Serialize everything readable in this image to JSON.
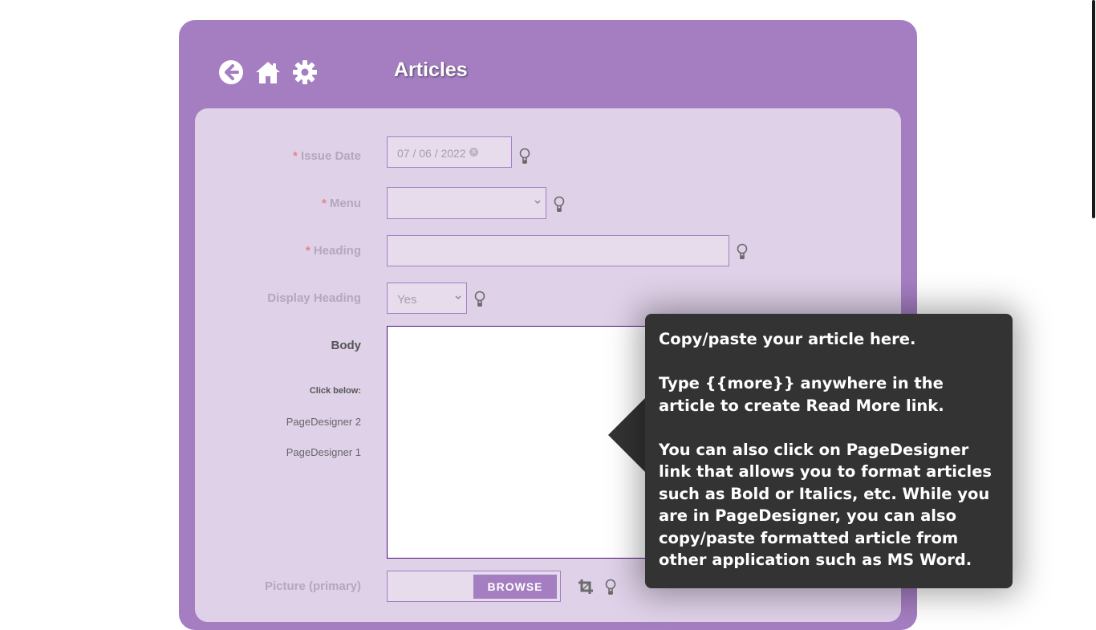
{
  "header": {
    "title": "Articles",
    "icons": [
      "back-arrow-icon",
      "home-icon",
      "gear-icon"
    ]
  },
  "form": {
    "issue_date": {
      "label": "Issue Date",
      "required_mark": "*",
      "value": "07 / 06 / 2022"
    },
    "menu": {
      "label": "Menu",
      "required_mark": "*",
      "value": ""
    },
    "heading": {
      "label": "Heading",
      "required_mark": "*",
      "value": ""
    },
    "display_heading": {
      "label": "Display Heading",
      "value": "Yes"
    },
    "body": {
      "label": "Body",
      "click_below": "Click below:",
      "links": [
        "PageDesigner 2",
        "PageDesigner 1"
      ],
      "value": ""
    },
    "picture": {
      "label": "Picture (primary)",
      "browse_label": "BROWSE"
    }
  },
  "tooltip": {
    "paragraphs": [
      "Copy/paste your article here.",
      "Type {{more}} anywhere in the article to create Read More link.",
      "You can also click on PageDesigner link that allows you to format articles such as Bold or Italics, etc. While you are in PageDesigner, you can also copy/paste formatted article from other application such as MS Word."
    ]
  },
  "colors": {
    "panel": "#a47ec1",
    "inner_panel": "#dfd1e8",
    "field_bg": "#e6dcec",
    "required": "#e58383",
    "tooltip_bg": "#333333"
  }
}
